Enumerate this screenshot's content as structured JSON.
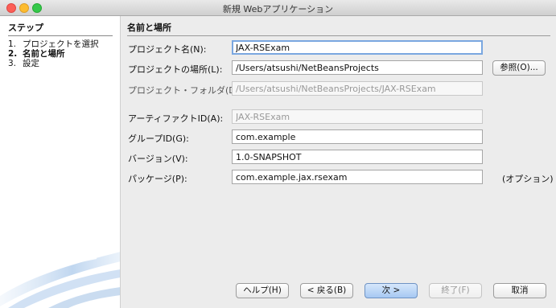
{
  "window": {
    "title": "新規 Webアプリケーション"
  },
  "sidebar": {
    "heading": "ステップ",
    "steps": [
      {
        "num": "1.",
        "label": "プロジェクトを選択"
      },
      {
        "num": "2.",
        "label": "名前と場所"
      },
      {
        "num": "3.",
        "label": "設定"
      }
    ]
  },
  "panel": {
    "title": "名前と場所",
    "project_name": {
      "label": "プロジェクト名(N):",
      "value": "JAX-RSExam"
    },
    "project_location": {
      "label": "プロジェクトの場所(L):",
      "value": "/Users/atsushi/NetBeansProjects",
      "browse": "参照(O)..."
    },
    "project_folder": {
      "label": "プロジェクト・フォルダ(D):",
      "value": "/Users/atsushi/NetBeansProjects/JAX-RSExam"
    },
    "artifact_id": {
      "label": "アーティファクトID(A):",
      "value": "JAX-RSExam"
    },
    "group_id": {
      "label": "グループID(G):",
      "value": "com.example"
    },
    "version": {
      "label": "バージョン(V):",
      "value": "1.0-SNAPSHOT"
    },
    "package": {
      "label": "パッケージ(P):",
      "value": "com.example.jax.rsexam",
      "hint": "(オプション)"
    }
  },
  "buttons": {
    "help": "ヘルプ(H)",
    "back": "< 戻る(B)",
    "next": "次 >",
    "finish": "終了(F)",
    "cancel": "取消"
  }
}
